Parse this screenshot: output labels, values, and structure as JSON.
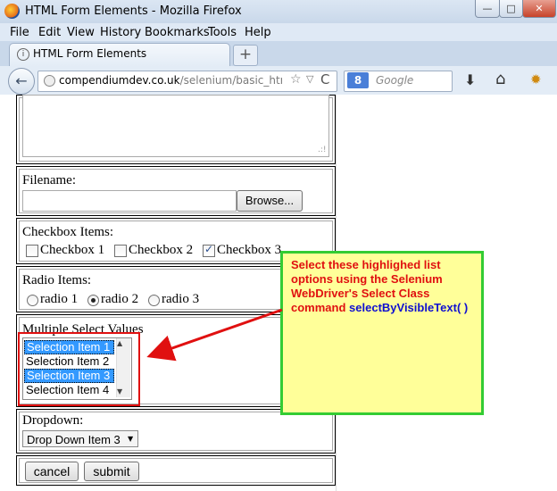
{
  "window": {
    "title": "HTML Form Elements - Mozilla Firefox",
    "min": "—",
    "max": "□",
    "close": "✕"
  },
  "menu": [
    "File",
    "Edit",
    "View",
    "History",
    "Bookmarks",
    "Tools",
    "Help"
  ],
  "tab": {
    "label": "HTML Form Elements",
    "new_tab": "+"
  },
  "nav": {
    "back": "←",
    "url_host": "compendiumdev.co.uk",
    "url_path": "/selenium/basic_html_fo",
    "star": "☆",
    "dropdown": "▽",
    "reload": "C",
    "search_engine": "8",
    "search_placeholder": "Google",
    "download": "⬇",
    "home": "⌂",
    "addon": "✹"
  },
  "form": {
    "textarea_grip": ".:!",
    "filename_label": "Filename:",
    "browse_label": "Browse...",
    "checkbox_label": "Checkbox Items:",
    "checkboxes": [
      {
        "label": "Checkbox 1",
        "checked": false
      },
      {
        "label": "Checkbox 2",
        "checked": false
      },
      {
        "label": "Checkbox 3",
        "checked": true
      }
    ],
    "radio_label": "Radio Items:",
    "radios": [
      {
        "label": "radio 1",
        "checked": false
      },
      {
        "label": "radio 2",
        "checked": true
      },
      {
        "label": "radio 3",
        "checked": false
      }
    ],
    "multi_label": "Multiple Select Values",
    "multi_options": [
      {
        "label": "Selection Item 1",
        "selected": true
      },
      {
        "label": "Selection Item 2",
        "selected": false
      },
      {
        "label": "Selection Item 3",
        "selected": true
      },
      {
        "label": "Selection Item 4",
        "selected": false
      }
    ],
    "scroll_up": "▲",
    "scroll_down": "▼",
    "dropdown_label": "Dropdown:",
    "dropdown_value": "Drop Down Item 3",
    "dropdown_arrow": "▼",
    "cancel_label": "cancel",
    "submit_label": "submit"
  },
  "annotation": {
    "text": "Select these highlighed list options using the Selenium WebDriver's Select Class command",
    "command": "selectByVisibleText( )",
    "colors": {
      "text": "#e01010",
      "command": "#1010d0",
      "background": "#ffff99",
      "border": "#33cc33",
      "arrow": "#e01010"
    }
  }
}
